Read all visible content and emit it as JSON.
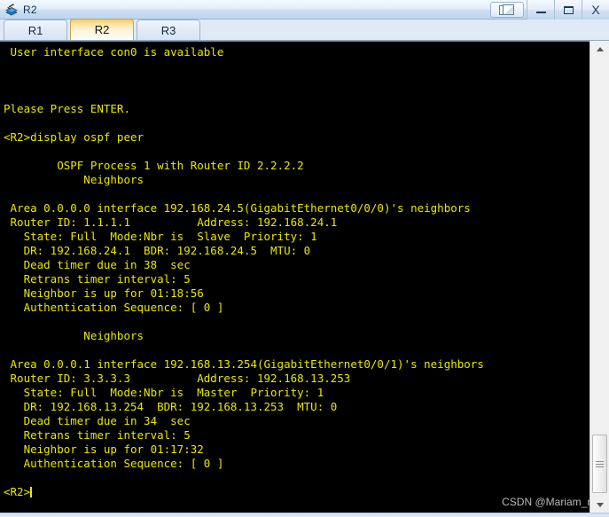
{
  "window": {
    "title": "R2",
    "icon": "router-device-icon",
    "buttons": {
      "restore_group": "cascade-windows-icon",
      "minimize": "minimize-icon",
      "maximize": "maximize-icon",
      "close": "X"
    }
  },
  "tabs": [
    {
      "label": "R1",
      "active": false
    },
    {
      "label": "R2",
      "active": true
    },
    {
      "label": "R3",
      "active": false
    }
  ],
  "terminal": {
    "foreground_color": "#e8e800",
    "background_color": "#000000",
    "prompt": "<R2>",
    "command": "display ospf peer",
    "lines": [
      " User interface con0 is available",
      "",
      "",
      "",
      "Please Press ENTER.",
      "",
      "<R2>display ospf peer",
      "",
      "        OSPF Process 1 with Router ID 2.2.2.2",
      "            Neighbors",
      "",
      " Area 0.0.0.0 interface 192.168.24.5(GigabitEthernet0/0/0)'s neighbors",
      " Router ID: 1.1.1.1          Address: 192.168.24.1",
      "   State: Full  Mode:Nbr is  Slave  Priority: 1",
      "   DR: 192.168.24.1  BDR: 192.168.24.5  MTU: 0",
      "   Dead timer due in 38  sec",
      "   Retrans timer interval: 5",
      "   Neighbor is up for 01:18:56",
      "   Authentication Sequence: [ 0 ]",
      "",
      "            Neighbors",
      "",
      " Area 0.0.0.1 interface 192.168.13.254(GigabitEthernet0/0/1)'s neighbors",
      " Router ID: 3.3.3.3          Address: 192.168.13.253",
      "   State: Full  Mode:Nbr is  Master  Priority: 1",
      "   DR: 192.168.13.254  BDR: 192.168.13.253  MTU: 0",
      "   Dead timer due in 34  sec",
      "   Retrans timer interval: 5",
      "   Neighbor is up for 01:17:32",
      "   Authentication Sequence: [ 0 ]",
      ""
    ],
    "last_line": "<R2>",
    "watermark": "CSDN @Mariam_me"
  },
  "scrollbar": {
    "up_arrow": "scroll-up-icon",
    "down_arrow": "scroll-down-icon",
    "thumb": "scroll-thumb"
  }
}
